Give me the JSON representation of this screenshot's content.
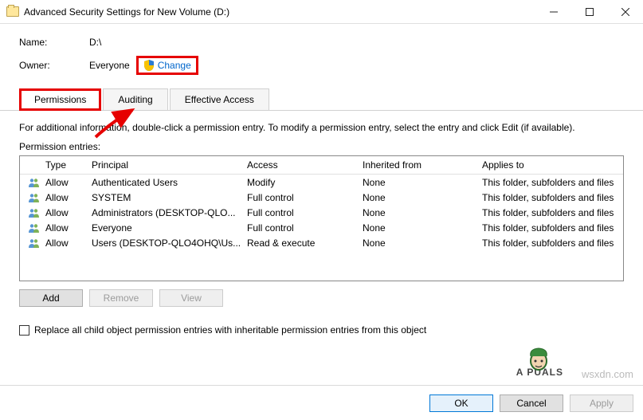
{
  "window": {
    "title": "Advanced Security Settings for New Volume (D:)"
  },
  "fields": {
    "name_label": "Name:",
    "name_value": "D:\\",
    "owner_label": "Owner:",
    "owner_value": "Everyone",
    "change_link": "Change"
  },
  "tabs": {
    "permissions": "Permissions",
    "auditing": "Auditing",
    "effective": "Effective Access"
  },
  "info_text": "For additional information, double-click a permission entry. To modify a permission entry, select the entry and click Edit (if available).",
  "entries_label": "Permission entries:",
  "columns": {
    "type": "Type",
    "principal": "Principal",
    "access": "Access",
    "inherited": "Inherited from",
    "applies": "Applies to"
  },
  "rows": [
    {
      "type": "Allow",
      "principal": "Authenticated Users",
      "access": "Modify",
      "inherited": "None",
      "applies": "This folder, subfolders and files"
    },
    {
      "type": "Allow",
      "principal": "SYSTEM",
      "access": "Full control",
      "inherited": "None",
      "applies": "This folder, subfolders and files"
    },
    {
      "type": "Allow",
      "principal": "Administrators (DESKTOP-QLO...",
      "access": "Full control",
      "inherited": "None",
      "applies": "This folder, subfolders and files"
    },
    {
      "type": "Allow",
      "principal": "Everyone",
      "access": "Full control",
      "inherited": "None",
      "applies": "This folder, subfolders and files"
    },
    {
      "type": "Allow",
      "principal": "Users (DESKTOP-QLO4OHQ\\Us...",
      "access": "Read & execute",
      "inherited": "None",
      "applies": "This folder, subfolders and files"
    }
  ],
  "buttons": {
    "add": "Add",
    "remove": "Remove",
    "view": "View",
    "ok": "OK",
    "cancel": "Cancel",
    "apply": "Apply"
  },
  "checkbox_label": "Replace all child object permission entries with inheritable permission entries from this object",
  "watermark": {
    "url": "wsxdn.com",
    "brand": "A  PUALS"
  }
}
